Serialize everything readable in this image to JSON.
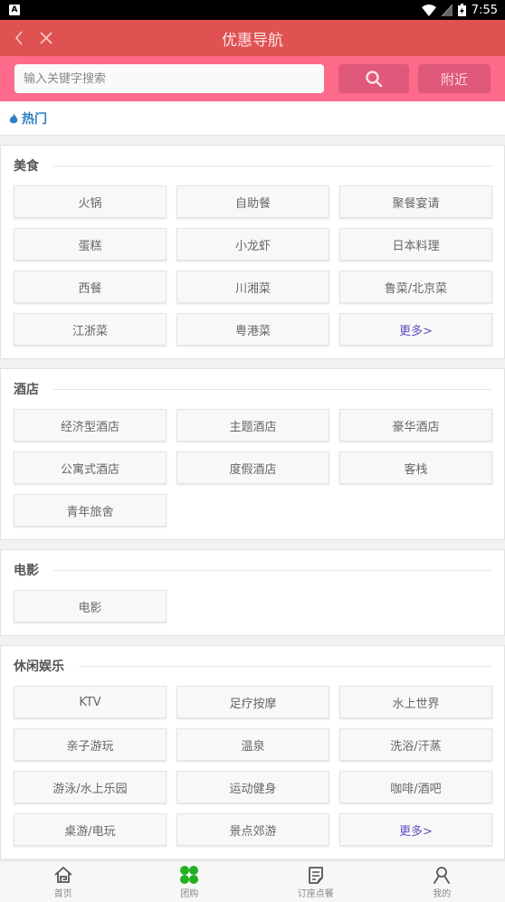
{
  "status_bar": {
    "left_icon": "notification-a-icon",
    "time": "7:55"
  },
  "header": {
    "title": "优惠导航",
    "back_icon": "back-chevron-icon",
    "close_icon": "close-icon"
  },
  "search": {
    "placeholder": "输入关键字搜索",
    "value": "",
    "search_icon": "search-icon",
    "nearby_label": "附近"
  },
  "hot": {
    "label": "热门",
    "icon": "flame-icon"
  },
  "colors": {
    "title_bar": "#e05252",
    "search_bar": "#fd6a8a",
    "hot_text": "#2f7fc1",
    "more_text": "#5b4fc2",
    "active_tab_icon": "#22b022"
  },
  "sections": [
    {
      "title": "美食",
      "items": [
        "火锅",
        "自助餐",
        "聚餐宴请",
        "蛋糕",
        "小龙虾",
        "日本料理",
        "西餐",
        "川湘菜",
        "鲁菜/北京菜",
        "江浙菜",
        "粤港菜",
        "更多>"
      ]
    },
    {
      "title": "酒店",
      "items": [
        "经济型酒店",
        "主题酒店",
        "豪华酒店",
        "公寓式酒店",
        "度假酒店",
        "客栈",
        "青年旅舍"
      ]
    },
    {
      "title": "电影",
      "items": [
        "电影"
      ]
    },
    {
      "title": "休闲娱乐",
      "items": [
        "KTV",
        "足疗按摩",
        "水上世界",
        "亲子游玩",
        "温泉",
        "洗浴/汗蒸",
        "游泳/水上乐园",
        "运动健身",
        "咖啡/酒吧",
        "桌游/电玩",
        "景点郊游",
        "更多>"
      ]
    }
  ],
  "tabbar": [
    {
      "label": "首页",
      "icon": "home-icon",
      "active": false
    },
    {
      "label": "团购",
      "icon": "grid-clover-icon",
      "active": true
    },
    {
      "label": "订座点餐",
      "icon": "order-list-icon",
      "active": false
    },
    {
      "label": "我的",
      "icon": "user-icon",
      "active": false
    }
  ]
}
